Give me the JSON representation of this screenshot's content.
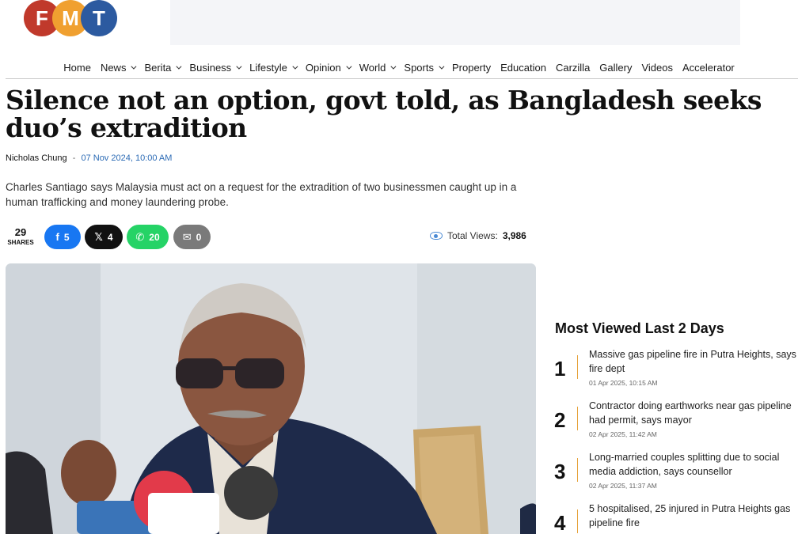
{
  "logo": {
    "letters": [
      "F",
      "M",
      "T"
    ],
    "colors": [
      "#c0392b",
      "#f0a030",
      "#2c5aa0"
    ]
  },
  "nav": {
    "items": [
      {
        "label": "Home",
        "dropdown": false
      },
      {
        "label": "News",
        "dropdown": true
      },
      {
        "label": "Berita",
        "dropdown": true
      },
      {
        "label": "Business",
        "dropdown": true
      },
      {
        "label": "Lifestyle",
        "dropdown": true
      },
      {
        "label": "Opinion",
        "dropdown": true
      },
      {
        "label": "World",
        "dropdown": true
      },
      {
        "label": "Sports",
        "dropdown": true
      },
      {
        "label": "Property",
        "dropdown": false
      },
      {
        "label": "Education",
        "dropdown": false
      },
      {
        "label": "Carzilla",
        "dropdown": false
      },
      {
        "label": "Gallery",
        "dropdown": false
      },
      {
        "label": "Videos",
        "dropdown": false
      },
      {
        "label": "Accelerator",
        "dropdown": false
      }
    ]
  },
  "article": {
    "headline": "Silence not an option, govt told, as Bangladesh seeks duo’s extradition",
    "author": "Nicholas Chung",
    "separator": "-",
    "date": "07 Nov 2024, 10:00 AM",
    "dek": "Charles Santiago says Malaysia must act on a request for the extradition of two businessmen caught up in a human trafficking and money laundering probe."
  },
  "share": {
    "total": "29",
    "total_label": "SHARES",
    "buttons": [
      {
        "icon": "facebook-icon",
        "glyph": "f",
        "count": "5",
        "color": "#1877f2"
      },
      {
        "icon": "x-icon",
        "glyph": "𝕏",
        "count": "4",
        "color": "#111111"
      },
      {
        "icon": "whatsapp-icon",
        "glyph": "✆",
        "count": "20",
        "color": "#25d366"
      },
      {
        "icon": "email-icon",
        "glyph": "✉",
        "count": "0",
        "color": "#7a7a7a"
      }
    ],
    "views_label": "Total Views:",
    "views_count": "3,986"
  },
  "sidebar": {
    "title": "Most Viewed Last 2 Days",
    "items": [
      {
        "rank": "1",
        "title": "Massive gas pipeline fire in Putra Heights, says fire dept",
        "date": "01 Apr 2025, 10:15 AM"
      },
      {
        "rank": "2",
        "title": "Contractor doing earthworks near gas pipeline had permit, says mayor",
        "date": "02 Apr 2025, 11:42 AM"
      },
      {
        "rank": "3",
        "title": "Long-married couples splitting due to social media addiction, says counsellor",
        "date": "02 Apr 2025, 11:37 AM"
      },
      {
        "rank": "4",
        "title": "5 hospitalised, 25 injured in Putra Heights gas pipeline fire",
        "date": ""
      }
    ]
  },
  "accent_color": "#e5a23a",
  "link_color": "#2c6bb5"
}
